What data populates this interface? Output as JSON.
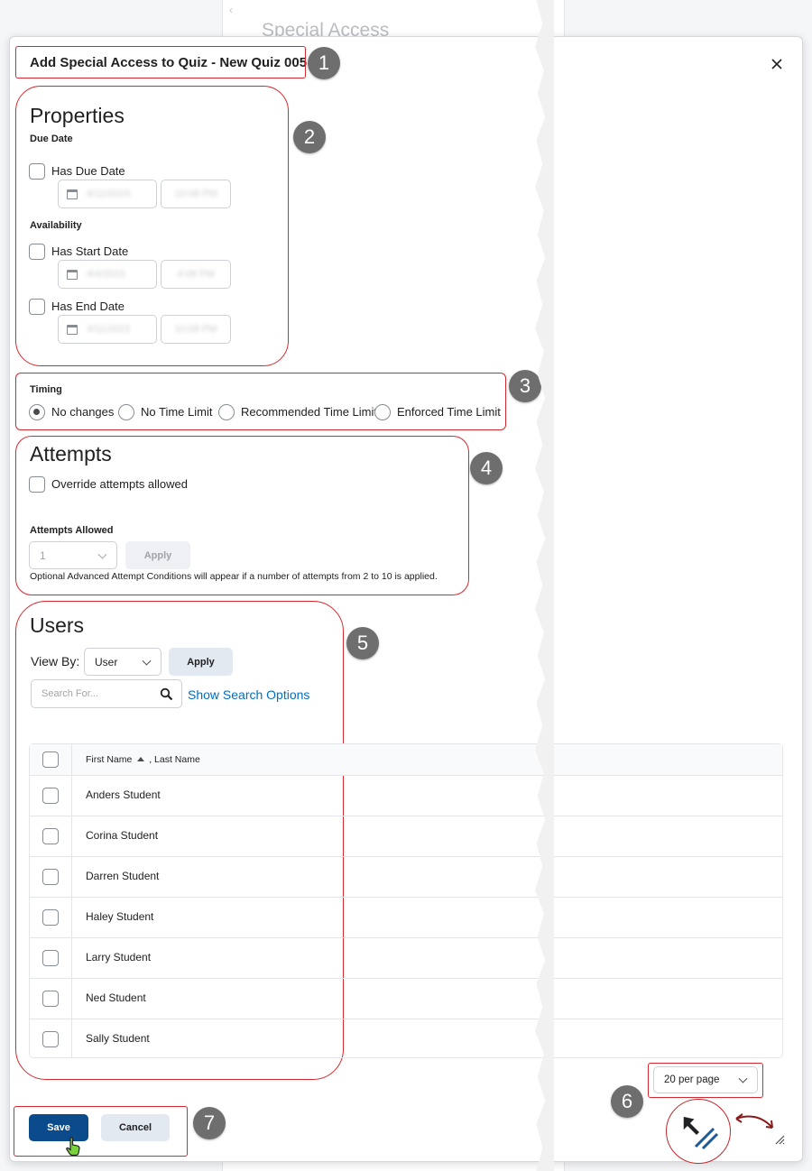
{
  "background": {
    "breadcrumb": "‹",
    "page_title": "Special Access"
  },
  "dialog": {
    "title": "Add Special Access to Quiz - New Quiz 005",
    "close_icon": "close-icon"
  },
  "properties": {
    "heading": "Properties",
    "due_date_label": "Due Date",
    "has_due_date": "Has Due Date",
    "due_date_value": "4/11/2023",
    "due_time_value": "10:08 PM",
    "availability_label": "Availability",
    "has_start_date": "Has Start Date",
    "start_date_value": "4/4/2023",
    "start_time_value": "4:08 PM",
    "has_end_date": "Has End Date",
    "end_date_value": "4/11/2023",
    "end_time_value": "10:08 PM"
  },
  "timing": {
    "label": "Timing",
    "options": [
      "No changes",
      "No Time Limit",
      "Recommended Time Limit",
      "Enforced Time Limit"
    ],
    "selected": "No changes"
  },
  "attempts": {
    "heading": "Attempts",
    "override_label": "Override attempts allowed",
    "allowed_label": "Attempts Allowed",
    "allowed_value": "1",
    "apply_label": "Apply",
    "note": "Optional Advanced Attempt Conditions will appear if a number of attempts from 2 to 10 is applied."
  },
  "users": {
    "heading": "Users",
    "view_by_label": "View By:",
    "view_by_value": "User",
    "apply_label": "Apply",
    "search_placeholder": "Search For...",
    "show_search_options": "Show Search Options",
    "column_first": "First Name",
    "column_sep": ", Last Name",
    "rows": [
      "Anders Student",
      "Corina Student",
      "Darren Student",
      "Haley Student",
      "Larry Student",
      "Ned Student",
      "Sally Student"
    ]
  },
  "pagination": {
    "per_page": "20 per page"
  },
  "footer": {
    "save_label": "Save",
    "cancel_label": "Cancel"
  },
  "callouts": [
    "1",
    "2",
    "3",
    "4",
    "5",
    "6",
    "7"
  ],
  "colors": {
    "callout_outline": "#d7282f",
    "primary": "#0b4a8b",
    "link": "#006fbf",
    "badge": "#6e6e6e"
  }
}
